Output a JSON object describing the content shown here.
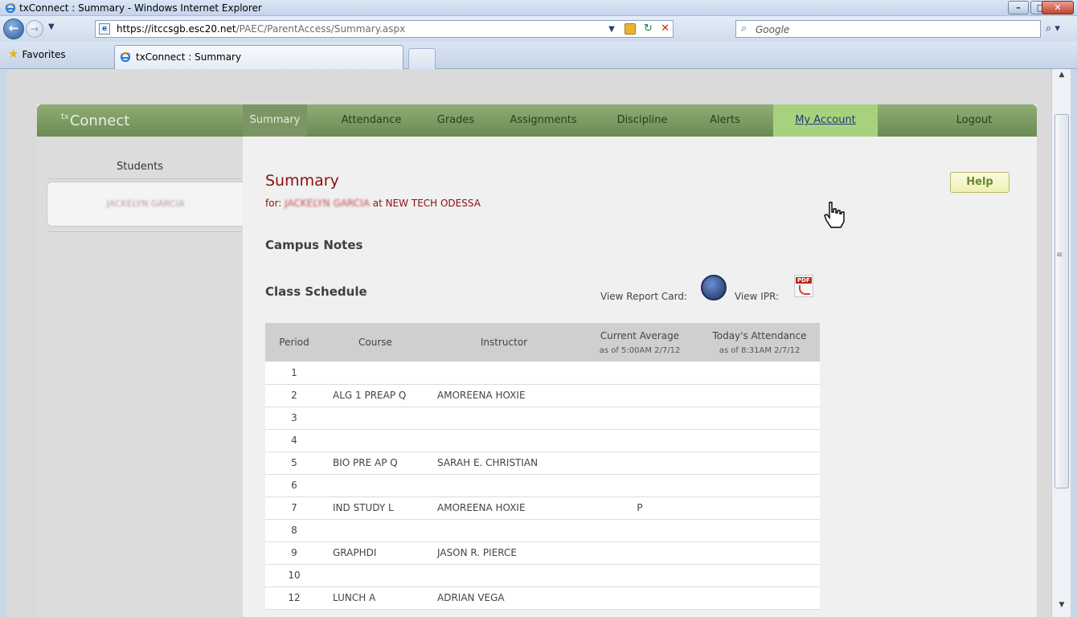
{
  "window": {
    "title": "txConnect : Summary - Windows Internet Explorer",
    "minimize": "–",
    "maximize": "□",
    "close": "✕"
  },
  "address": {
    "url_bold": "https://itccsgb.esc20.net",
    "url_rest": "/PAEC/ParentAccess/Summary.aspx",
    "search_placeholder": "Google"
  },
  "favorites": {
    "label": "Favorites",
    "tab_title": "txConnect : Summary"
  },
  "app": {
    "logo": "Connect",
    "logo_prefix": "tx",
    "nav": [
      {
        "label": "Summary"
      },
      {
        "label": "Attendance"
      },
      {
        "label": "Grades"
      },
      {
        "label": "Assignments"
      },
      {
        "label": "Discipline"
      },
      {
        "label": "Alerts"
      },
      {
        "label": "My Account"
      },
      {
        "label": "Logout"
      }
    ]
  },
  "sidebar": {
    "heading": "Students",
    "student_name": "JACKELYN GARCIA"
  },
  "summary": {
    "title": "Summary",
    "for_prefix": "for:",
    "student_name": "JACKELYN GARCIA",
    "at_text": "at NEW TECH ODESSA",
    "help": "Help",
    "campus_notes": "Campus Notes",
    "class_schedule": "Class Schedule",
    "view_report_card": "View Report Card:",
    "view_ipr": "View IPR:",
    "pdf_tag": "PDF"
  },
  "schedule": {
    "headers": {
      "period": "Period",
      "course": "Course",
      "instructor": "Instructor",
      "average": "Current Average",
      "average_sub": "as of 5:00AM 2/7/12",
      "attendance": "Today's Attendance",
      "attendance_sub": "as of 8:31AM 2/7/12"
    },
    "rows": [
      {
        "period": "1",
        "course": "",
        "instructor": "",
        "average": "",
        "attendance": ""
      },
      {
        "period": "2",
        "course": "ALG 1 PREAP Q",
        "instructor": "AMOREENA HOXIE",
        "average": "",
        "attendance": ""
      },
      {
        "period": "3",
        "course": "",
        "instructor": "",
        "average": "",
        "attendance": ""
      },
      {
        "period": "4",
        "course": "",
        "instructor": "",
        "average": "",
        "attendance": ""
      },
      {
        "period": "5",
        "course": "BIO PRE AP Q",
        "instructor": "SARAH E. CHRISTIAN",
        "average": "",
        "attendance": ""
      },
      {
        "period": "6",
        "course": "",
        "instructor": "",
        "average": "",
        "attendance": ""
      },
      {
        "period": "7",
        "course": "IND STUDY L",
        "instructor": "AMOREENA HOXIE",
        "average": "P",
        "attendance": ""
      },
      {
        "period": "8",
        "course": "",
        "instructor": "",
        "average": "",
        "attendance": ""
      },
      {
        "period": "9",
        "course": "GRAPHDI",
        "instructor": "JASON R. PIERCE",
        "average": "",
        "attendance": ""
      },
      {
        "period": "10",
        "course": "",
        "instructor": "",
        "average": "",
        "attendance": ""
      },
      {
        "period": "12",
        "course": "LUNCH A",
        "instructor": "ADRIAN VEGA",
        "average": "",
        "attendance": ""
      }
    ]
  }
}
